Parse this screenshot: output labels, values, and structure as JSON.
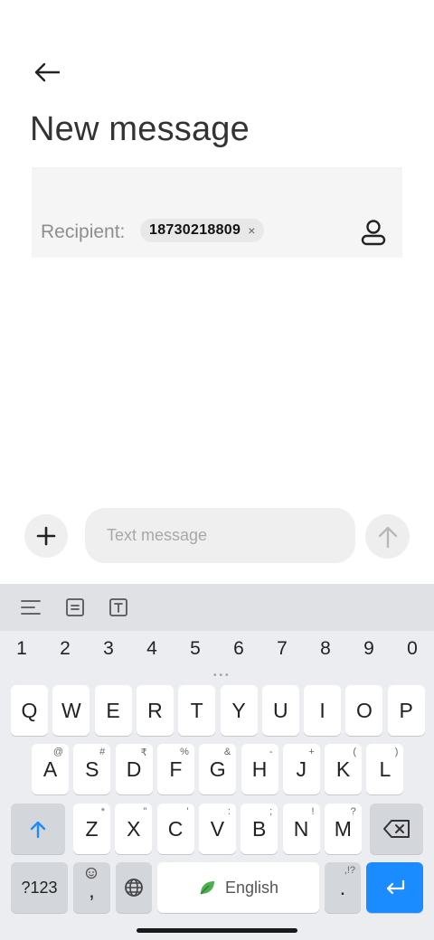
{
  "header": {
    "title": "New message"
  },
  "recipient": {
    "label": "Recipient:",
    "chip": "18730218809",
    "chip_remove": "×"
  },
  "composer": {
    "placeholder": "Text message"
  },
  "keyboard": {
    "numbers": [
      "1",
      "2",
      "3",
      "4",
      "5",
      "6",
      "7",
      "8",
      "9",
      "0"
    ],
    "row1": [
      {
        "k": "Q"
      },
      {
        "k": "W"
      },
      {
        "k": "E"
      },
      {
        "k": "R"
      },
      {
        "k": "T"
      },
      {
        "k": "Y"
      },
      {
        "k": "U"
      },
      {
        "k": "I"
      },
      {
        "k": "O"
      },
      {
        "k": "P"
      }
    ],
    "row2": [
      {
        "k": "A",
        "s": "@"
      },
      {
        "k": "S",
        "s": "#"
      },
      {
        "k": "D",
        "s": "₹"
      },
      {
        "k": "F",
        "s": "%"
      },
      {
        "k": "G",
        "s": "&"
      },
      {
        "k": "H",
        "s": "-"
      },
      {
        "k": "J",
        "s": "+"
      },
      {
        "k": "K",
        "s": "("
      },
      {
        "k": "L",
        "s": ")"
      }
    ],
    "row3": [
      {
        "k": "Z",
        "s": "*"
      },
      {
        "k": "X",
        "s": "\""
      },
      {
        "k": "C",
        "s": "'"
      },
      {
        "k": "V",
        "s": ":"
      },
      {
        "k": "B",
        "s": ";"
      },
      {
        "k": "N",
        "s": "!"
      },
      {
        "k": "M",
        "s": "?"
      }
    ],
    "symbols_label": "?123",
    "comma": ",",
    "space_label": "English",
    "period": ".",
    "period_sup": ",!?"
  },
  "colors": {
    "accent": "#1a8cff",
    "leaf": "#4caf50"
  }
}
